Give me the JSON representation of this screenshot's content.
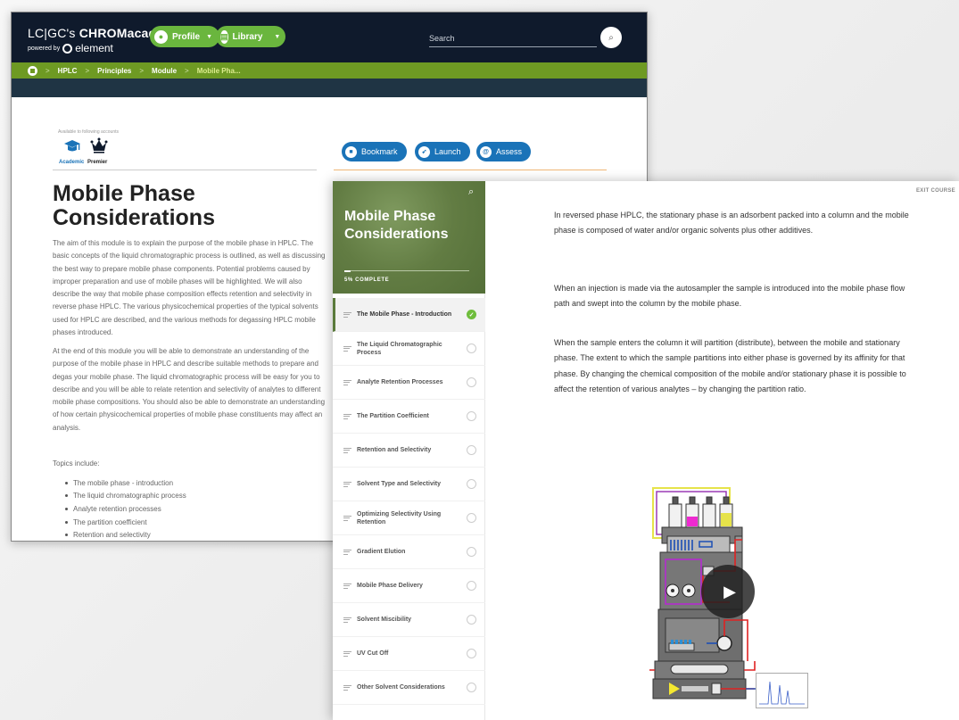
{
  "header": {
    "logo_main_prefix": "LC|GC's ",
    "logo_main_brand": "CHROMacademy",
    "logo_powered": "powered by",
    "logo_element": "element",
    "profile_label": "Profile",
    "library_label": "Library",
    "search_placeholder": "Search",
    "search_icon_glyph": "⌕"
  },
  "breadcrumb": {
    "items": [
      "HPLC",
      "Principles",
      "Module",
      "Mobile Pha..."
    ],
    "separator": ">"
  },
  "accounts": {
    "available_label": "Available to following accounts",
    "academic": "Academic",
    "premier": "Premier"
  },
  "actions": {
    "bookmark": "Bookmark",
    "launch": "Launch",
    "assess": "Assess"
  },
  "module": {
    "title": "Mobile Phase Considerations",
    "paragraph1": "The aim of this module is to explain the purpose of the mobile phase in HPLC. The basic concepts of the liquid chromatographic process is outlined, as well as discussing the best way to prepare mobile phase components. Potential problems caused by improper preparation and use of mobile phases will be highlighted. We will also describe the way that mobile phase composition effects retention and selectivity in reverse phase HPLC. The various physicochemical properties of the typical solvents used for HPLC are described, and the various methods for degassing HPLC mobile phases introduced.",
    "paragraph2": "At the end of this module you will be able to demonstrate an understanding of the purpose of the mobile phase in HPLC and describe suitable methods to prepare and degas your mobile phase. The liquid chromatographic process will be easy for you to describe and you will be able to relate retention and selectivity of analytes to different mobile phase compositions. You should also be able to demonstrate an understanding of how certain physicochemical properties of mobile phase constituents may affect an analysis.",
    "topics_title": "Topics include:",
    "topics": [
      "The mobile phase - introduction",
      "The liquid chromatographic process",
      "Analyte retention processes",
      "The partition coefficient",
      "Retention and selectivity"
    ]
  },
  "course": {
    "title": "Mobile Phase Considerations",
    "progress_label": "5% COMPLETE",
    "progress_fraction": 0.05,
    "exit_label": "EXIT COURSE",
    "lessons": [
      {
        "name": "The Mobile Phase - Introduction",
        "done": true
      },
      {
        "name": "The Liquid Chromatographic Process",
        "done": false
      },
      {
        "name": "Analyte Retention Processes",
        "done": false
      },
      {
        "name": "The Partition Coefficient",
        "done": false
      },
      {
        "name": "Retention and Selectivity",
        "done": false
      },
      {
        "name": "Solvent Type and Selectivity",
        "done": false
      },
      {
        "name": "Optimizing Selectivity Using Retention",
        "done": false
      },
      {
        "name": "Gradient Elution",
        "done": false
      },
      {
        "name": "Mobile Phase Delivery",
        "done": false
      },
      {
        "name": "Solvent Miscibility",
        "done": false
      },
      {
        "name": "UV Cut Off",
        "done": false
      },
      {
        "name": "Other Solvent Considerations",
        "done": false
      }
    ],
    "content": [
      "In reversed phase HPLC, the stationary phase is an adsorbent packed into a column and the mobile phase is composed of water and/or organic solvents plus other additives.",
      "When an injection is made via the autosampler the sample is introduced into the mobile phase flow path and swept into the column by the mobile phase.",
      "When the sample enters the column it will partition (distribute), between the mobile and stationary phase. The extent to which the sample partitions into either phase is governed by its affinity for that phase. By changing the chemical composition of the mobile and/or stationary phase it is possible to affect the retention of various analytes – by changing the partition ratio."
    ]
  },
  "colors": {
    "topbar": "#0f1a2c",
    "pill_green": "#6ab63e",
    "crumb_green": "#6e9a23",
    "action_blue": "#1a73b8",
    "hero_green": "#627c43",
    "done_green": "#6fbd3c"
  },
  "icons": {
    "profile": "person-icon",
    "library": "book-icon",
    "bookmark": "bookmark-icon",
    "launch": "rocket-icon",
    "assess": "assess-icon",
    "academic": "graduation-cap-icon",
    "premier": "crown-icon",
    "play": "play-icon"
  }
}
